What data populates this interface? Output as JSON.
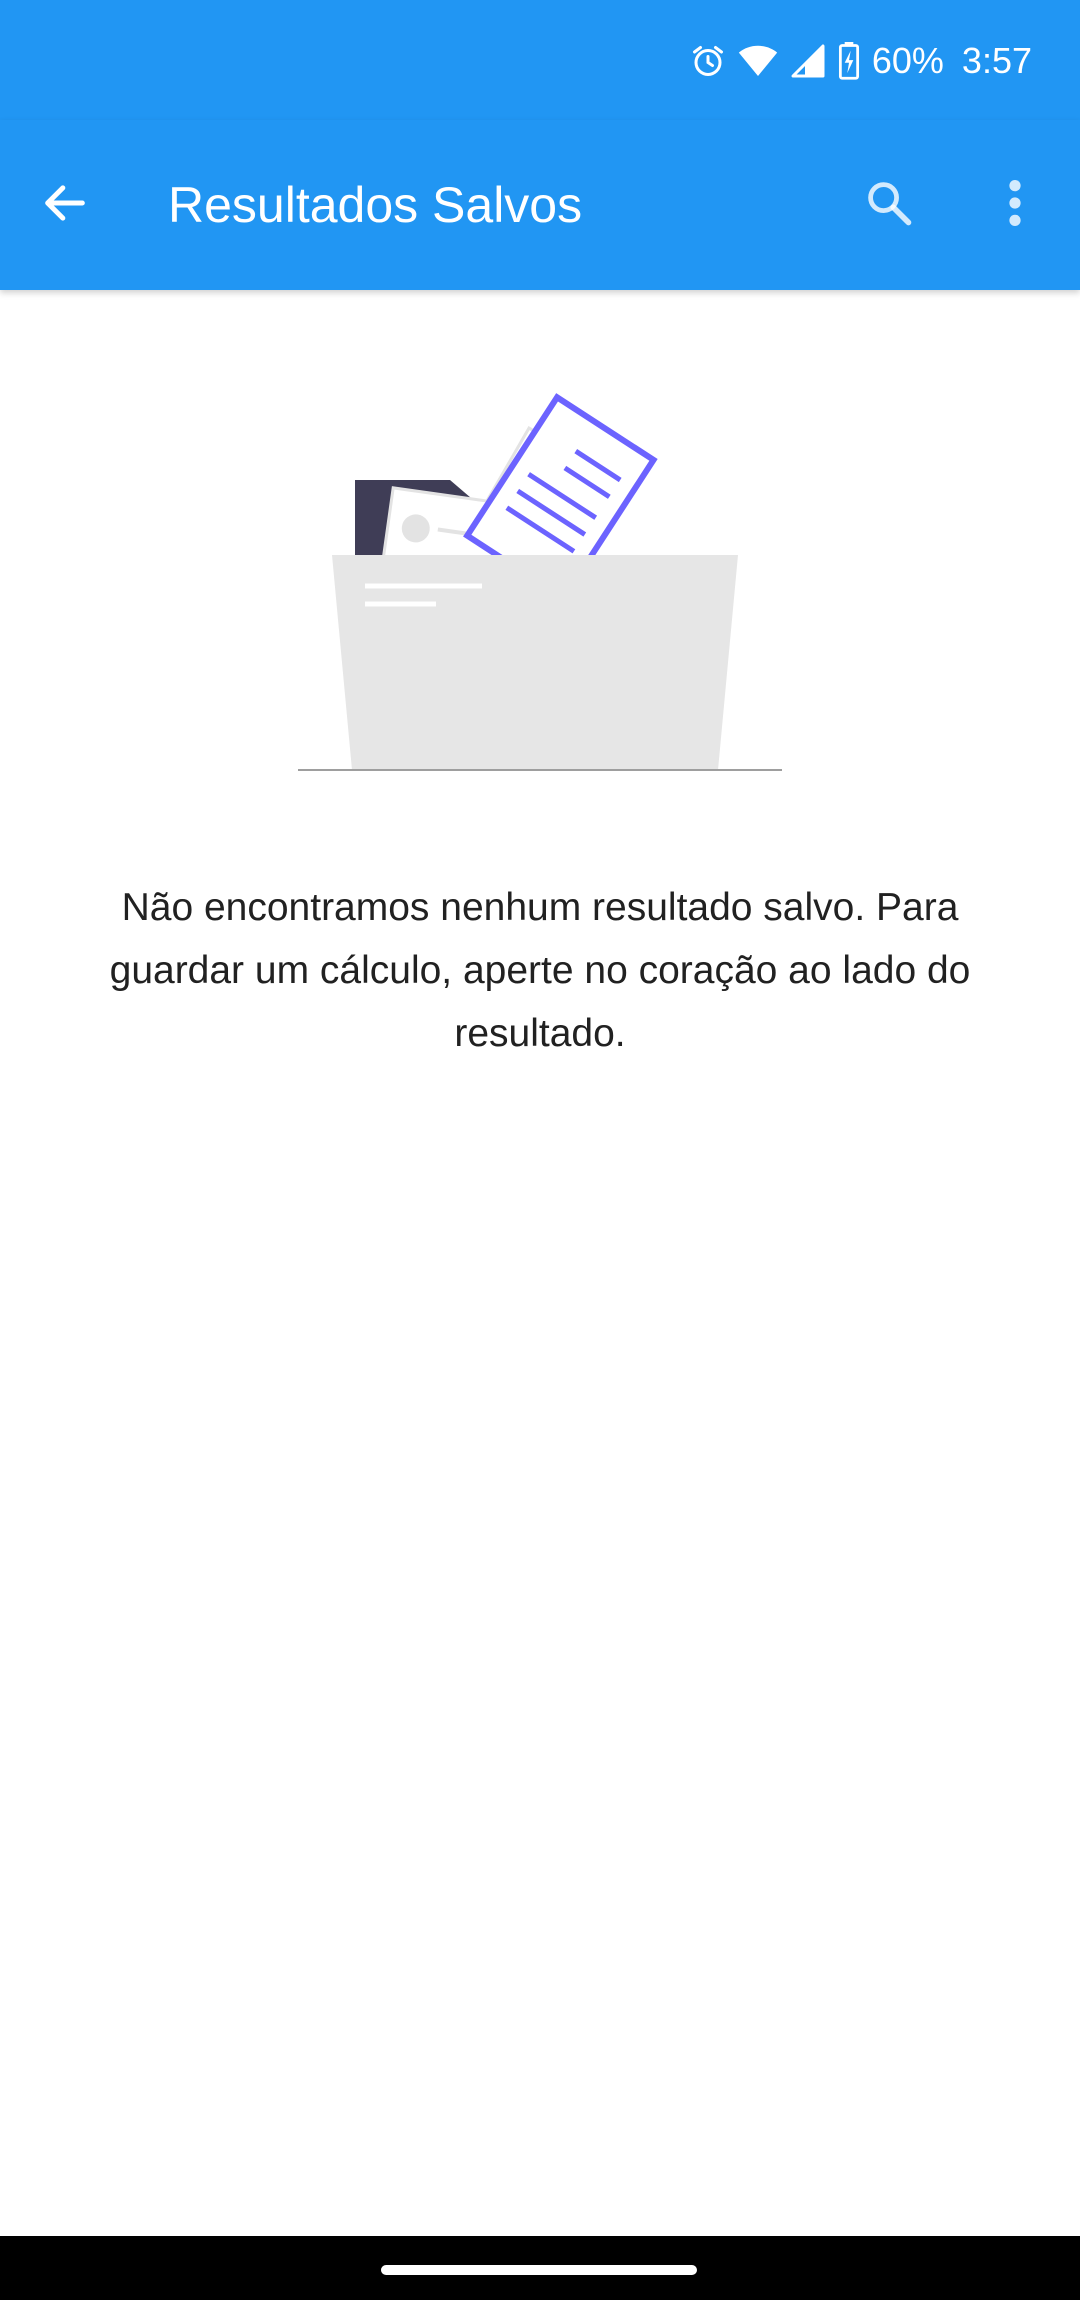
{
  "status_bar": {
    "battery": "60%",
    "time": "3:57",
    "icons": [
      "alarm-icon",
      "wifi-icon",
      "signal-icon",
      "battery-charging-icon"
    ]
  },
  "app_bar": {
    "title": "Resultados Salvos",
    "actions": [
      "back-arrow-icon",
      "search-icon",
      "more-vert-icon"
    ]
  },
  "empty_state": {
    "message": "Não encontramos nenhum resultado salvo. Para guardar um cálculo, aperte no coração ao lado do resultado.",
    "illustration": "folder-with-documents"
  },
  "colors": {
    "primary": "#2196F3",
    "accent": "#6C63FF",
    "dark": "#3F3D56",
    "folder": "#E6E6E6"
  }
}
